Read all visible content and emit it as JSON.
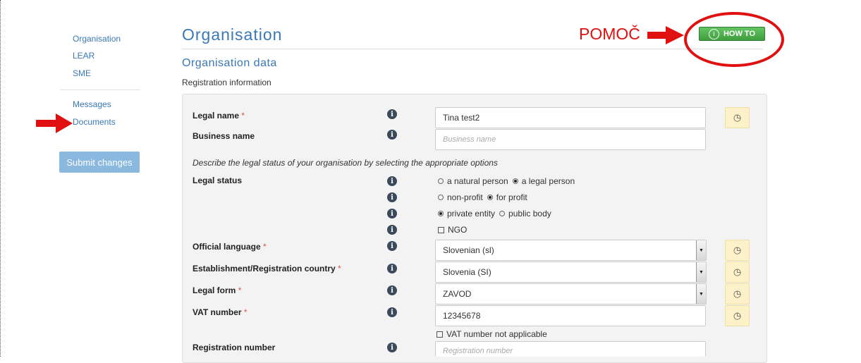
{
  "sidebar": {
    "items": [
      {
        "label": "Organisation"
      },
      {
        "label": "LEAR"
      },
      {
        "label": "SME"
      },
      {
        "label": "Messages"
      },
      {
        "label": "Documents"
      }
    ],
    "submit_label": "Submit changes"
  },
  "header": {
    "title": "Organisation",
    "section": "Organisation data",
    "subsection": "Registration information",
    "howto_label": "HOW TO",
    "annotation": "POMOČ"
  },
  "form": {
    "required_mark": "*",
    "legal_name": {
      "label": "Legal name",
      "value": "Tina test2"
    },
    "business_name": {
      "label": "Business name",
      "placeholder": "Business name"
    },
    "legal_status_desc": "Describe the legal status of your organisation by selecting the appropriate options",
    "legal_status": {
      "label": "Legal status",
      "natural_person": "a natural person",
      "legal_person": "a legal person",
      "non_profit": "non-profit",
      "for_profit": "for profit",
      "private_entity": "private entity",
      "public_body": "public body",
      "ngo": "NGO"
    },
    "official_language": {
      "label": "Official language",
      "value": "Slovenian (sl)"
    },
    "establishment_country": {
      "label": "Establishment/Registration country",
      "value": "Slovenia (SI)"
    },
    "legal_form": {
      "label": "Legal form",
      "value": "ZAVOD"
    },
    "vat_number": {
      "label": "VAT number",
      "value": "12345678",
      "not_applicable": "VAT number not applicable"
    },
    "registration_number": {
      "label": "Registration number",
      "placeholder": "Registration number"
    }
  },
  "colors": {
    "accent": "#3a78b8",
    "annotation_red": "#e01010",
    "howto_green": "#4cae4c",
    "history_bg": "#fdf1c9"
  }
}
